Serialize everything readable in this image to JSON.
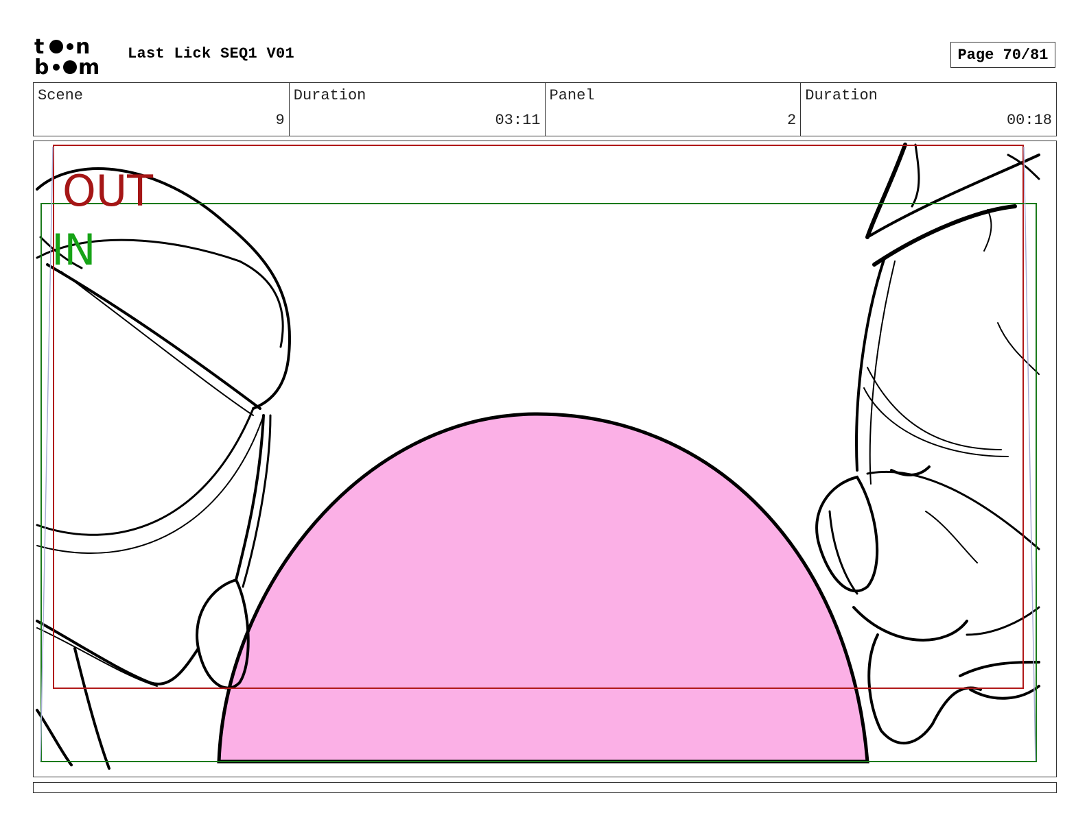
{
  "header": {
    "logo": {
      "line1": "toon",
      "line2": "boom"
    },
    "title": "Last Lick SEQ1 V01",
    "page_label": "Page 70/81"
  },
  "info": {
    "scene_label": "Scene",
    "scene_value": "9",
    "scene_duration_label": "Duration",
    "scene_duration_value": "03:11",
    "panel_label": "Panel",
    "panel_value": "2",
    "panel_duration_label": "Duration",
    "panel_duration_value": "00:18"
  },
  "panel": {
    "out_label": "OUT",
    "in_label": "IN",
    "colors": {
      "out_frame": "#b01818",
      "in_frame": "#1a7a1a",
      "in_text": "#16a316",
      "fill": "#fbb0e6",
      "line": "#000000"
    }
  },
  "caption": {}
}
